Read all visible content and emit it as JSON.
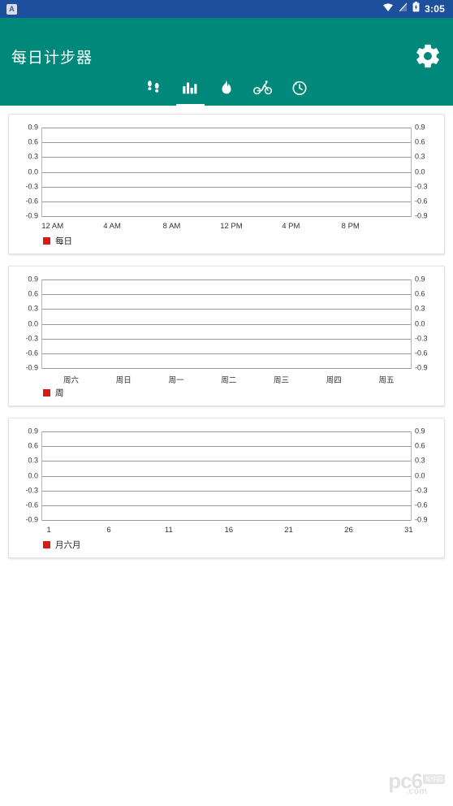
{
  "status_bar": {
    "notification_icon": "app-notification-icon",
    "notification_letter": "A",
    "wifi_icon": "wifi-icon",
    "signal_off_icon": "signal-off-icon",
    "battery_icon": "battery-charging-icon",
    "time": "3:05",
    "background_color": "#1c4f9c"
  },
  "app_bar": {
    "title": "每日计步器",
    "settings_icon": "gear-icon",
    "background_color": "#00897b",
    "tabs": [
      {
        "name": "tab-steps",
        "icon": "footsteps-icon",
        "active": false
      },
      {
        "name": "tab-chart",
        "icon": "bar-chart-icon",
        "active": true
      },
      {
        "name": "tab-calories",
        "icon": "flame-icon",
        "active": false
      },
      {
        "name": "tab-cycling",
        "icon": "bicycle-icon",
        "active": false
      },
      {
        "name": "tab-history",
        "icon": "history-icon",
        "active": false
      }
    ]
  },
  "legend_color": "#d91b18",
  "chart_data": [
    {
      "type": "line",
      "name": "daily-chart",
      "title": "",
      "xlabel": "",
      "ylabel": "",
      "categories": [
        "12 AM",
        "4 AM",
        "8 AM",
        "12 PM",
        "4 PM",
        "8 PM"
      ],
      "series": [
        {
          "name": "每日",
          "values": []
        }
      ],
      "yticks": [
        "0.9",
        "0.6",
        "0.3",
        "0.0",
        "-0.3",
        "-0.6",
        "-0.9"
      ],
      "ylim": [
        -0.9,
        0.9
      ],
      "grid": true,
      "dual_y_axis": true,
      "legend_position": "bottom-left",
      "legend": [
        "每日"
      ]
    },
    {
      "type": "line",
      "name": "weekly-chart",
      "title": "",
      "xlabel": "",
      "ylabel": "",
      "categories": [
        "周六",
        "周日",
        "周一",
        "周二",
        "周三",
        "周四",
        "周五"
      ],
      "series": [
        {
          "name": "周",
          "values": []
        }
      ],
      "yticks": [
        "0.9",
        "0.6",
        "0.3",
        "0.0",
        "-0.3",
        "-0.6",
        "-0.9"
      ],
      "ylim": [
        -0.9,
        0.9
      ],
      "grid": true,
      "dual_y_axis": true,
      "legend_position": "bottom-left",
      "legend": [
        "周"
      ]
    },
    {
      "type": "line",
      "name": "monthly-chart",
      "title": "",
      "xlabel": "",
      "ylabel": "",
      "categories": [
        "1",
        "6",
        "11",
        "16",
        "21",
        "26",
        "31"
      ],
      "series": [
        {
          "name": "月六月",
          "values": []
        }
      ],
      "yticks": [
        "0.9",
        "0.6",
        "0.3",
        "0.0",
        "-0.3",
        "-0.6",
        "-0.9"
      ],
      "ylim": [
        -0.9,
        0.9
      ],
      "grid": true,
      "dual_y_axis": true,
      "legend_position": "bottom-left",
      "legend": [
        "月六月"
      ]
    }
  ],
  "watermark": {
    "text": "pc6",
    "suffix": ".com",
    "badge": "软件园"
  }
}
